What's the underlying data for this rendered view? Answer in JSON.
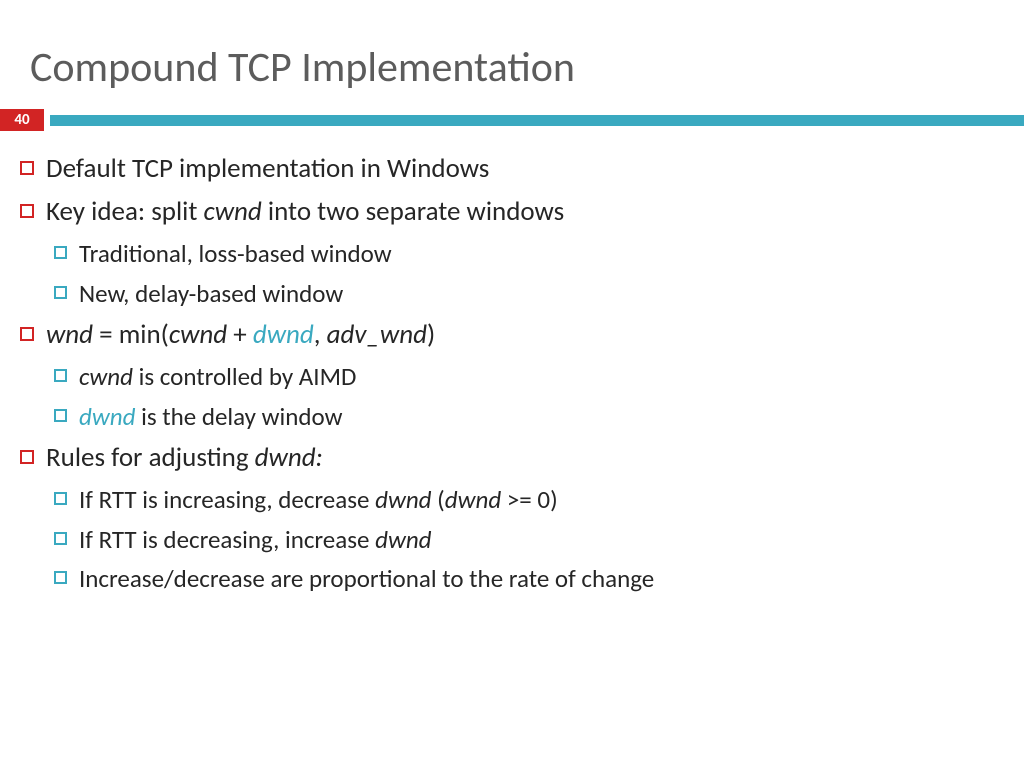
{
  "title": "Compound TCP Implementation",
  "pageNumber": "40",
  "bullets": {
    "b1": "Default TCP implementation in Windows",
    "b2_pre": "Key idea: split ",
    "b2_it1": "cwnd",
    "b2_post": " into two separate windows",
    "b2a": "Traditional, loss-based window",
    "b2b": "New, delay-based window",
    "b3_it1": "wnd",
    "b3_mid1": " = min(",
    "b3_it2": "cwnd",
    "b3_mid2": " + ",
    "b3_teal": "dwnd",
    "b3_mid3": ", ",
    "b3_it3": "adv_wnd",
    "b3_post": ")",
    "b3a_it": "cwnd",
    "b3a_post": " is controlled by AIMD",
    "b3b_teal": "dwnd",
    "b3b_post": " is the delay window",
    "b4_pre": "Rules for adjusting ",
    "b4_it": "dwnd:",
    "b4a_pre": "If RTT is increasing, decrease ",
    "b4a_it1": "dwnd",
    "b4a_mid": " (",
    "b4a_it2": "dwnd",
    "b4a_post": " >= 0)",
    "b4b_pre": "If RTT is decreasing, increase ",
    "b4b_it": "dwnd",
    "b4c": "Increase/decrease are proportional to the rate of change"
  }
}
